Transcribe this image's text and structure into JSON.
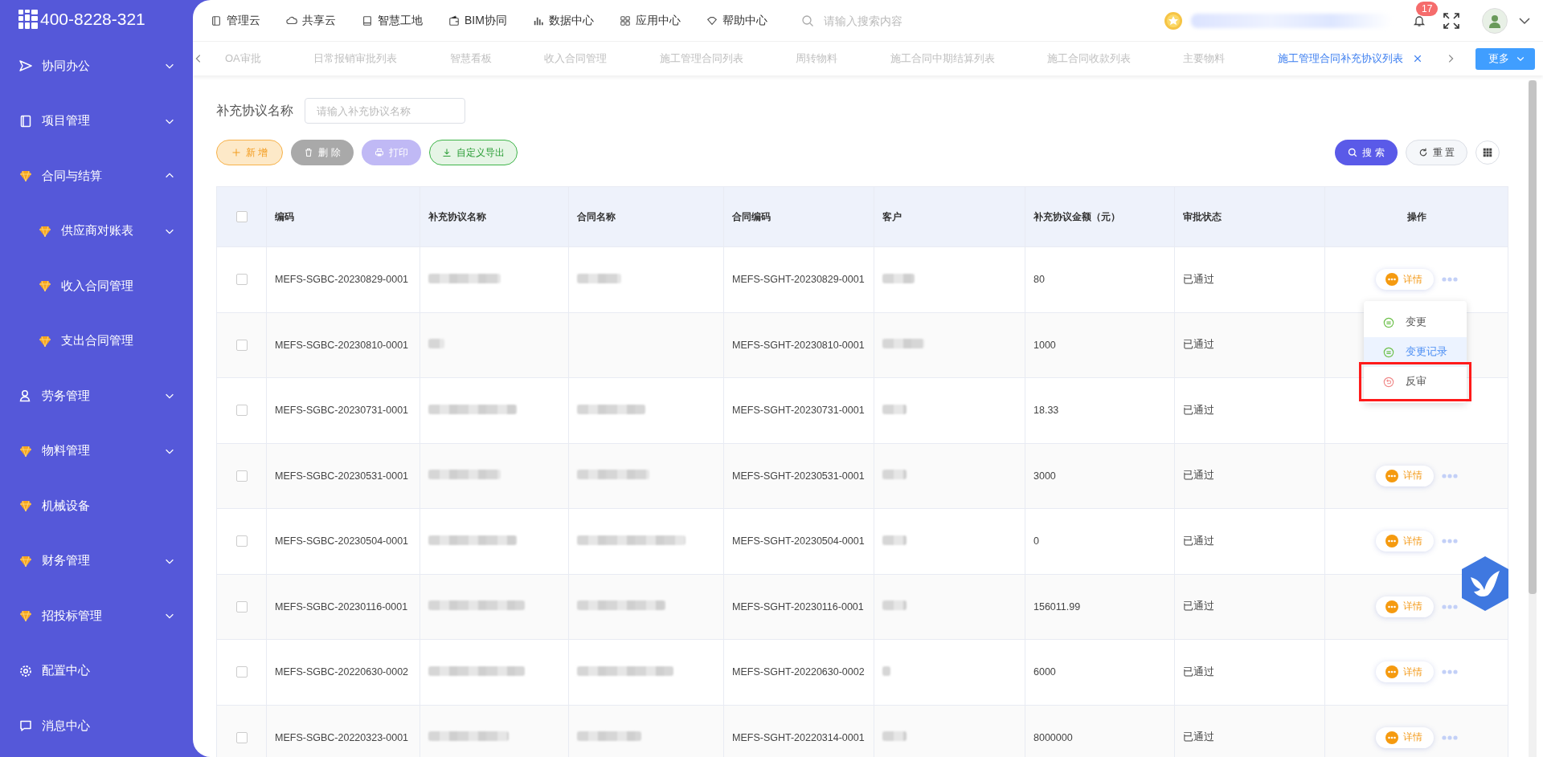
{
  "brand": {
    "phone": "400-8228-321"
  },
  "sidebar": {
    "items": [
      {
        "label": "协同办公",
        "expanded": false
      },
      {
        "label": "项目管理",
        "expanded": false
      },
      {
        "label": "合同与结算",
        "expanded": true,
        "children": [
          {
            "label": "供应商对账表",
            "expanded": false
          },
          {
            "label": "收入合同管理"
          },
          {
            "label": "支出合同管理"
          }
        ]
      },
      {
        "label": "劳务管理",
        "expanded": false
      },
      {
        "label": "物料管理",
        "expanded": false
      },
      {
        "label": "机械设备"
      },
      {
        "label": "财务管理",
        "expanded": false
      },
      {
        "label": "招投标管理",
        "expanded": false
      },
      {
        "label": "配置中心"
      },
      {
        "label": "消息中心"
      }
    ]
  },
  "topnav": {
    "items": [
      "管理云",
      "共享云",
      "智慧工地",
      "BIM协同",
      "数据中心",
      "应用中心",
      "帮助中心"
    ],
    "search": {
      "placeholder": "请输入搜索内容"
    },
    "notifications": {
      "count": "17"
    }
  },
  "tabs": [
    {
      "label": "OA审批",
      "selected": false
    },
    {
      "label": "日常报销审批列表",
      "selected": false
    },
    {
      "label": "智慧看板",
      "selected": false
    },
    {
      "label": "收入合同管理",
      "selected": false
    },
    {
      "label": "施工管理合同列表",
      "selected": false
    },
    {
      "label": "周转物料",
      "selected": false
    },
    {
      "label": "施工合同中期结算列表",
      "selected": false
    },
    {
      "label": "施工合同收款列表",
      "selected": false
    },
    {
      "label": "主要物料",
      "selected": false
    },
    {
      "label": "施工管理合同补充协议列表",
      "selected": true
    }
  ],
  "more_button": "更多",
  "filter": {
    "label": "补充协议名称",
    "placeholder": "请输入补充协议名称"
  },
  "actions": [
    {
      "kind": "add",
      "label": "新 增"
    },
    {
      "kind": "delete",
      "label": "删 除"
    },
    {
      "kind": "print",
      "label": "打印"
    },
    {
      "kind": "export",
      "label": "自定义导出"
    }
  ],
  "search_button": "搜 索",
  "reset_button": "重 置",
  "table": {
    "select_all_checked": false,
    "columns": [
      "编码",
      "补充协议名称",
      "合同名称",
      "合同编码",
      "客户",
      "补充协议金额（元）",
      "审批状态",
      "操作"
    ],
    "rows": [
      {
        "checked": false,
        "code": "MEFS-SGBC-20230829-0001",
        "contract_code": "MEFS-SGHT-20230829-0001",
        "amount": "80",
        "status": "已通过",
        "action": "详情"
      },
      {
        "checked": false,
        "code": "MEFS-SGBC-20230810-0001",
        "contract_code": "MEFS-SGHT-20230810-0001",
        "amount": "1000",
        "status": "已通过"
      },
      {
        "checked": false,
        "code": "MEFS-SGBC-20230731-0001",
        "contract_code": "MEFS-SGHT-20230731-0001",
        "amount": "18.33",
        "status": "已通过"
      },
      {
        "checked": false,
        "code": "MEFS-SGBC-20230531-0001",
        "contract_code": "MEFS-SGHT-20230531-0001",
        "amount": "3000",
        "status": "已通过",
        "action": "详情"
      },
      {
        "checked": false,
        "code": "MEFS-SGBC-20230504-0001",
        "contract_code": "MEFS-SGHT-20230504-0001",
        "amount": "0",
        "status": "已通过",
        "action": "详情"
      },
      {
        "checked": false,
        "code": "MEFS-SGBC-20230116-0001",
        "contract_code": "MEFS-SGHT-20230116-0001",
        "amount": "156011.99",
        "status": "已通过",
        "action": "详情"
      },
      {
        "checked": false,
        "code": "MEFS-SGBC-20220630-0002",
        "contract_code": "MEFS-SGHT-20220630-0002",
        "amount": "6000",
        "status": "已通过",
        "action": "详情"
      },
      {
        "checked": false,
        "code": "MEFS-SGBC-20220323-0001",
        "contract_code": "MEFS-SGHT-20220314-0001",
        "amount": "8000000",
        "status": "已通过",
        "action": "详情"
      }
    ]
  },
  "row_menu": {
    "items": [
      {
        "kind": "change",
        "label": "变更",
        "hovered": false,
        "highlighted": false
      },
      {
        "kind": "change",
        "label": "变更记录",
        "hovered": true,
        "highlighted": false
      },
      {
        "kind": "reverse",
        "label": "反审",
        "hovered": false,
        "highlighted": true
      }
    ]
  }
}
